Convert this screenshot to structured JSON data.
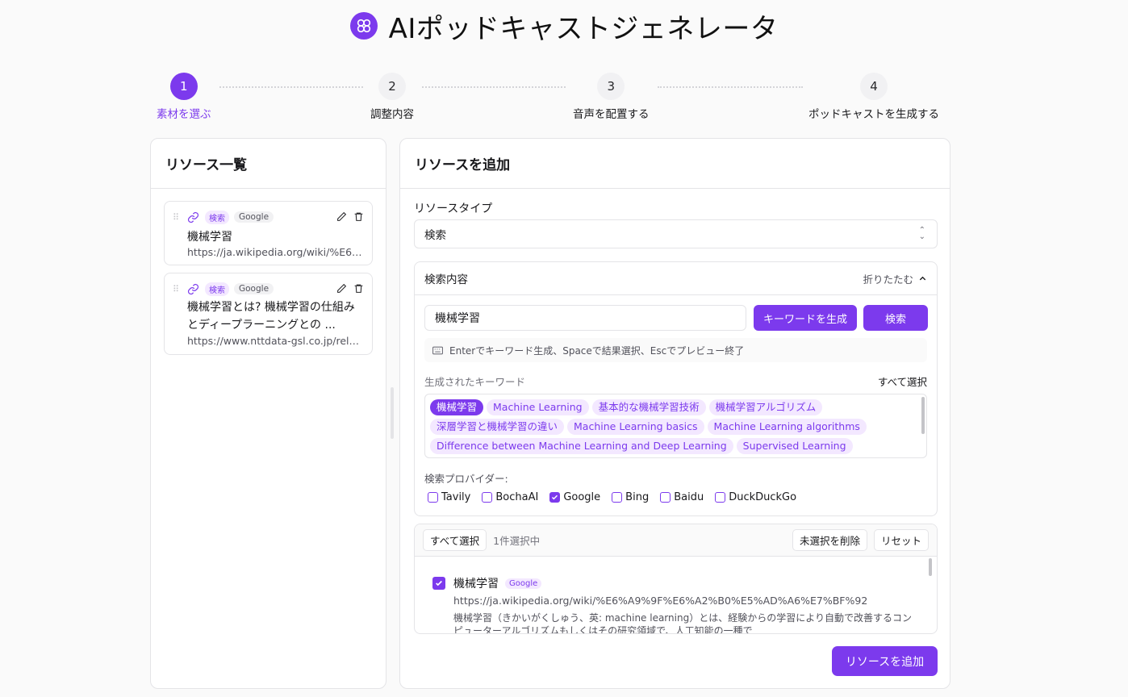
{
  "app": {
    "title": "AIポッドキャストジェネレータ"
  },
  "steps": [
    {
      "num": "1",
      "label": "素材を選ぶ",
      "active": true
    },
    {
      "num": "2",
      "label": "調整内容"
    },
    {
      "num": "3",
      "label": "音声を配置する"
    },
    {
      "num": "4",
      "label": "ポッドキャストを生成する"
    }
  ],
  "left": {
    "title": "リソース一覧",
    "cards": [
      {
        "type": "検索",
        "provider": "Google",
        "title": "機械学習",
        "url": "https://ja.wikipedia.org/wiki/%E6%A..."
      },
      {
        "type": "検索",
        "provider": "Google",
        "title": "機械学習とは? 機械学習の仕組みとディープラーニングとの ...",
        "url": "https://www.nttdata-gsl.co.jp/relate..."
      }
    ]
  },
  "right": {
    "title": "リソースを追加",
    "type_label": "リソースタイプ",
    "type_value": "検索",
    "search_section": {
      "title": "検索内容",
      "collapse": "折りたたむ",
      "input_value": "機械学習",
      "gen_button": "キーワードを生成",
      "search_button": "検索",
      "hint": "Enterでキーワード生成、Spaceで結果選択、Escでプレビュー終了",
      "kw_label": "生成されたキーワード",
      "select_all": "すべて選択",
      "keywords": [
        "機械学習",
        "Machine Learning",
        "基本的な機械学習技術",
        "機械学習アルゴリズム",
        "深層学習と機械学習の違い",
        "Machine Learning basics",
        "Machine Learning algorithms",
        "Difference between Machine Learning and Deep Learning",
        "Supervised Learning"
      ],
      "providers_label": "検索プロバイダー:",
      "providers": [
        {
          "name": "Tavily",
          "checked": false
        },
        {
          "name": "BochaAI",
          "checked": false
        },
        {
          "name": "Google",
          "checked": true
        },
        {
          "name": "Bing",
          "checked": false
        },
        {
          "name": "Baidu",
          "checked": false
        },
        {
          "name": "DuckDuckGo",
          "checked": false
        }
      ]
    },
    "results": {
      "select_all": "すべて選択",
      "count": "1件選択中",
      "delete_unselected": "未選択を削除",
      "reset": "リセット",
      "item": {
        "title": "機械学習",
        "badge": "Google",
        "url": "https://ja.wikipedia.org/wiki/%E6%A9%9F%E6%A2%B0%E5%AD%A6%E7%BF%92",
        "desc": "機械学習（きかいがくしゅう、英: machine learning）とは、経験からの学習により自動で改善するコンピューターアルゴリズムもしくはその研究領域で、人工知能の一種で"
      }
    },
    "add_button": "リソースを追加"
  }
}
